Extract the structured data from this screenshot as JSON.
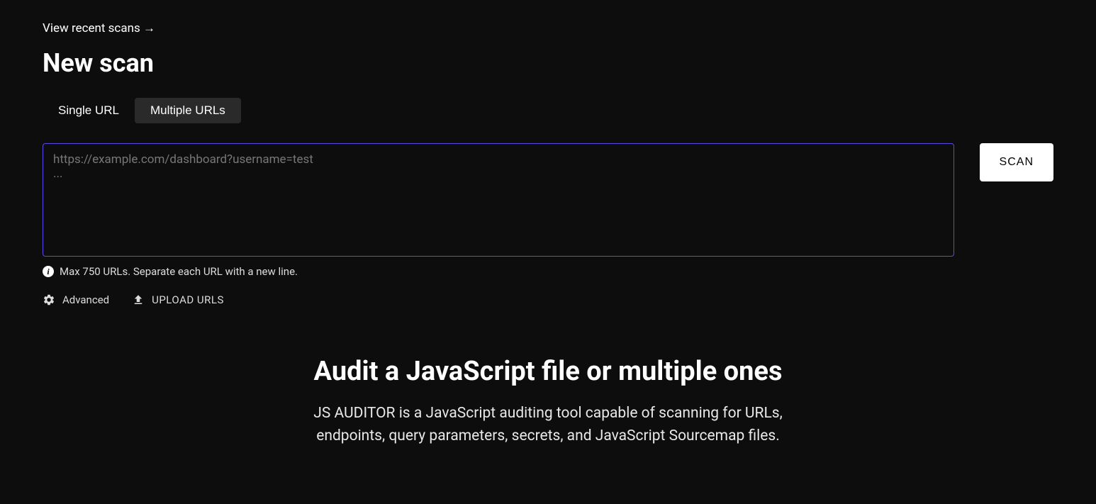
{
  "recent_link": "View recent scans →",
  "page_title": "New scan",
  "tabs": {
    "single": "Single URL",
    "multiple": "Multiple URLs"
  },
  "textarea": {
    "placeholder": "https://example.com/dashboard?username=test\n...",
    "value": ""
  },
  "scan_button": "SCAN",
  "hint": "Max 750 URLs. Separate each URL with a new line.",
  "actions": {
    "advanced": "Advanced",
    "upload": "UPLOAD URLS"
  },
  "hero": {
    "title": "Audit a JavaScript file or multiple ones",
    "description": "JS AUDITOR is a JavaScript auditing tool capable of scanning for URLs, endpoints, query parameters, secrets, and JavaScript Sourcemap files."
  }
}
